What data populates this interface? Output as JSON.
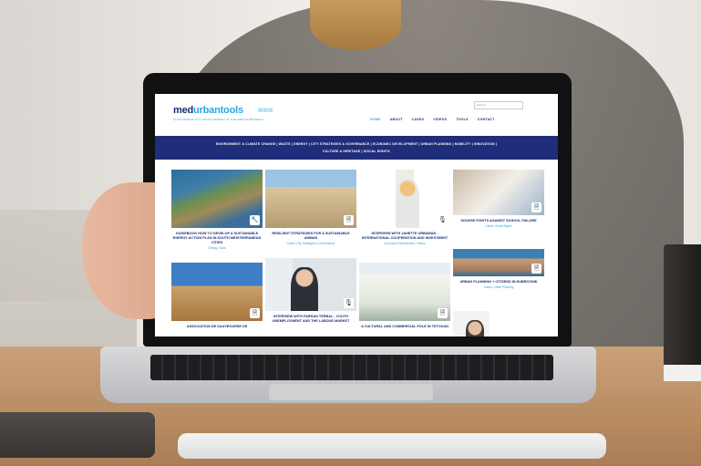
{
  "site": {
    "logo_med": "med",
    "logo_tools": "urbantools",
    "logo_wave": "≈≈≈",
    "tagline": "SUSTAINABLE CITY DEVELOPMENT IN THE MEDITERRANEAN",
    "search_placeholder": "Search",
    "nav": [
      "HOME",
      "ABOUT",
      "CASES",
      "VIDEOS",
      "TOOLS",
      "CONTACT"
    ],
    "categories_row1": "ENVIRONMENT & CLIMATE CHANGE | WASTE | ENERGY | CITY STRATEGIES & GOVERNANCE | ECONOMIC DEVELOPMENT | URBAN PLANNING | MOBILITY | INNOVATION |",
    "categories_row2": "CULTURE & HERITAGE | SOCIAL RIGHTS"
  },
  "cards": [
    {
      "title": "GUIDEBOOK HOW TO DEVELOP A SUSTAINABLE ENERGY ACTION PLAN IN SOUTH MEDITERRANEAN CITIES",
      "sub": "Energy, Tools",
      "icon": "wrench-icon"
    },
    {
      "title": "RESILIENT STRATEGIES FOR A SUSTAINABLE AMMAN",
      "sub": "Cases, City Strategies & Governance",
      "icon": "document-icon"
    },
    {
      "title": "INTERVIEW WITH JANETTE URBAWAN - INTERNATIONAL COOPERATION AND INVESTMENT",
      "sub": "Economic Development, Videos",
      "icon": "microphone-icon"
    },
    {
      "title": "SOUSSE FIGHTS AGAINST SCHOOL FAILURE",
      "sub": "Cases, Social Rights",
      "icon": "document-icon"
    },
    {
      "title": "ASSOCIATION DE SAUVEGARDE DE",
      "sub": "",
      "icon": "document-icon"
    },
    {
      "title": "INTERVIEW WITH FARHAN TERBAL - YOUTH UNEMPLOYMENT AND THE LABOUR MARKET",
      "sub": "",
      "icon": "microphone-icon"
    },
    {
      "title": "A CULTURAL AND COMMERCIAL POLE IN TETOUAN",
      "sub": "",
      "icon": "document-icon"
    },
    {
      "title": "URBAN PLANNING + CITIZENS IN DUBROVNIK",
      "sub": "Cases, Urban Planning",
      "icon": "document-icon"
    }
  ],
  "icons": {
    "wrench": "🔧",
    "document": "🗎",
    "microphone": "🎙"
  }
}
